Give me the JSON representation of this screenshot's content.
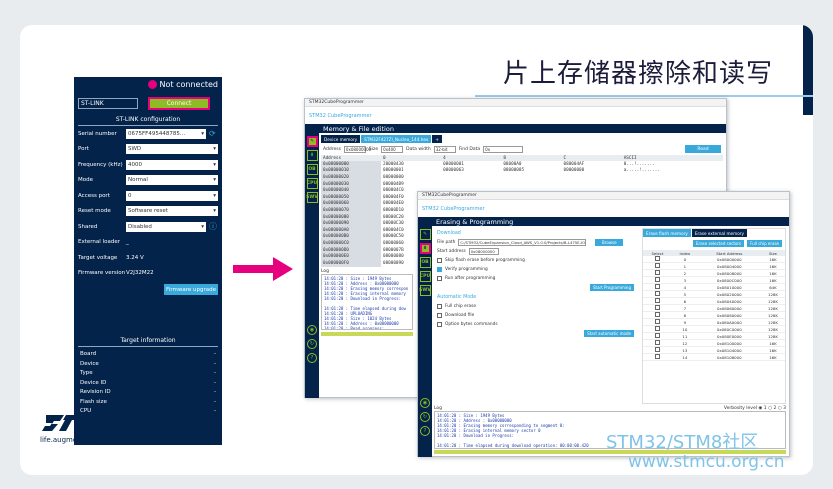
{
  "slide": {
    "title": "片上存储器擦除和读写",
    "brand_text": "life.augmented",
    "watermark_line1": "STM32/STM8社区",
    "watermark_line2": "www.stmcu.org.cn"
  },
  "stlink_panel": {
    "status": "Not connected",
    "interface": "ST-LINK",
    "connect_label": "Connect",
    "config_header": "ST-LINK configuration",
    "fields": [
      {
        "label": "Serial number",
        "value": "0675FF495448785..."
      },
      {
        "label": "Port",
        "value": "SWD"
      },
      {
        "label": "Frequency (kHz)",
        "value": "4000"
      },
      {
        "label": "Mode",
        "value": "Normal"
      },
      {
        "label": "Access port",
        "value": "0"
      },
      {
        "label": "Reset mode",
        "value": "Software reset"
      },
      {
        "label": "Shared",
        "value": "Disabled"
      }
    ],
    "external_loader_label": "External loader",
    "external_loader_value": "_",
    "target_voltage_label": "Target voltage",
    "target_voltage_value": "3.24 V",
    "firmware_label": "Firmware version",
    "firmware_value": "V2J32M22",
    "firmware_upgrade_label": "Firmware upgrade",
    "target_info_header": "Target information",
    "target_info": [
      {
        "label": "Board",
        "value": "-"
      },
      {
        "label": "Device",
        "value": "-"
      },
      {
        "label": "Type",
        "value": "-"
      },
      {
        "label": "Device ID",
        "value": "-"
      },
      {
        "label": "Revision ID",
        "value": "-"
      },
      {
        "label": "Flash size",
        "value": "-"
      },
      {
        "label": "CPU",
        "value": "-"
      }
    ]
  },
  "memory_window": {
    "titlebar": "STM32CubeProgrammer",
    "logo_text": "CubeProgrammer",
    "header": "Memory & File edition",
    "tabs": [
      "Device memory",
      "STM32F427ZI_Nucleo_144.hex",
      "+"
    ],
    "address_label": "Address",
    "address_value": "0x08000000",
    "size_label": "Size",
    "size_value": "0x400",
    "width_label": "Data width",
    "width_value": "32-bit",
    "find_label": "Find Data",
    "find_value": "0x",
    "read_label": "Read",
    "columns": [
      "Address",
      "0",
      "4",
      "8",
      "C",
      "ASCII"
    ],
    "rows": [
      [
        "0x08000000",
        "20000430",
        "08000001",
        "08000A0",
        "080004AF",
        "0...!......."
      ],
      [
        "0x08000010",
        "08000001",
        "08000063",
        "08000085",
        "00000000",
        "a.....!......."
      ],
      [
        "0x08000020",
        "00000000",
        "",
        "",
        "",
        ""
      ],
      [
        "0x08000030",
        "080004B9",
        "",
        "",
        "",
        ""
      ],
      [
        "0x08000040",
        "080004C0",
        "",
        "",
        "",
        ""
      ],
      [
        "0x08000050",
        "080004F0",
        "",
        "",
        "",
        ""
      ],
      [
        "0x08000060",
        "080004E0",
        "",
        "",
        "",
        ""
      ],
      [
        "0x08000070",
        "08000D10",
        "",
        "",
        "",
        ""
      ],
      [
        "0x08000080",
        "08000C20",
        "",
        "",
        "",
        ""
      ],
      [
        "0x08000090",
        "08000C30",
        "",
        "",
        "",
        ""
      ],
      [
        "0x080000A0",
        "080004C0",
        "",
        "",
        "",
        ""
      ],
      [
        "0x080000B0",
        "08000C50",
        "",
        "",
        "",
        ""
      ],
      [
        "0x080000C0",
        "08000060",
        "",
        "",
        "",
        ""
      ],
      [
        "0x080000D0",
        "0800007B",
        "",
        "",
        "",
        ""
      ],
      [
        "0x080000E0",
        "08000080",
        "",
        "",
        "",
        ""
      ],
      [
        "0x080000F0",
        "08000090",
        "",
        "",
        "",
        ""
      ]
    ],
    "log_label": "Log",
    "log_lines": [
      "14:01:20 : Size : 1949 Bytes",
      "14:01:20 : Address : 0x08000000",
      "14:01:20 : Erasing memory correspon",
      "14:01:20 : Erasing internal memory",
      "14:01:20 : Download in Progress:",
      "",
      "14:01:20 : Time elapsed during dow",
      "14:01:20 : UPLOADING",
      "14:01:20 : Size : 1024 Bytes",
      "14:01:20 : Address : 0x08000000",
      "14:01:20 : Read progress:",
      "",
      "14:01:20 : Time elapsed during the"
    ]
  },
  "erase_window": {
    "titlebar": "STM32CubeProgrammer",
    "logo_text": "CubeProgrammer",
    "header": "Erasing & Programming",
    "download_title": "Download",
    "file_path_label": "File path",
    "file_path_value": "C:/STM32/CubeExpansion_Cloud_AWS_V1.0.0/Projects/B-L475E-IOT01A/Applications",
    "browse_label": "Browse",
    "start_address_label": "Start address",
    "start_address_value": "0x08000000",
    "checkboxes": [
      {
        "label": "Skip flash erase before programming",
        "checked": false
      },
      {
        "label": "Verify programming",
        "checked": true
      },
      {
        "label": "Run after programming",
        "checked": false
      }
    ],
    "start_prog_label": "Start Programming",
    "auto_mode_title": "Automatic Mode",
    "auto_checkboxes": [
      {
        "label": "Full chip erase",
        "checked": false
      },
      {
        "label": "Download file",
        "checked": false
      },
      {
        "label": "Option bytes commands",
        "checked": false
      }
    ],
    "start_auto_label": "Start automatic mode",
    "sector_tabs": [
      "Erase flash memory",
      "Erase external memory"
    ],
    "erase_selected_label": "Erase selected sectors",
    "full_erase_label": "Full chip erase",
    "sector_columns": [
      "Select",
      "Index",
      "Start Address",
      "Size"
    ],
    "sectors": [
      [
        "0",
        "0x08000000",
        "16K"
      ],
      [
        "1",
        "0x08004000",
        "16K"
      ],
      [
        "2",
        "0x08008000",
        "16K"
      ],
      [
        "3",
        "0x0800C000",
        "16K"
      ],
      [
        "4",
        "0x08010000",
        "64K"
      ],
      [
        "5",
        "0x08020000",
        "128K"
      ],
      [
        "6",
        "0x08040000",
        "128K"
      ],
      [
        "7",
        "0x08060000",
        "128K"
      ],
      [
        "8",
        "0x08080000",
        "128K"
      ],
      [
        "9",
        "0x080A0000",
        "128K"
      ],
      [
        "10",
        "0x080C0000",
        "128K"
      ],
      [
        "11",
        "0x080E0000",
        "128K"
      ],
      [
        "12",
        "0x08100000",
        "16K"
      ],
      [
        "13",
        "0x08104000",
        "16K"
      ],
      [
        "14",
        "0x08108000",
        "16K"
      ]
    ],
    "log_label": "Log",
    "verbosity_label": "Verbosity level",
    "verbosity_options": [
      "1",
      "2",
      "3"
    ],
    "log_lines": [
      "14:01:20 : Size : 1949 Bytes",
      "14:01:20 : Address : 0x08000000",
      "14:01:20 : Erasing memory corresponding to segment 0:",
      "14:01:20 : Erasing internal memory sector 0",
      "14:01:20 : Download in Progress:",
      "",
      "14:01:20 : Time elapsed during download operation: 00:00:00.420",
      "14:01:20 : UPLOADING",
      "14:01:20 : Size : 1024 Bytes",
      "14:01:20 : Address : 0x08000000",
      "14:01:20 : Read progress:",
      "",
      "14:01:20 : Time elapsed during the read operation is: 00:00:00.007"
    ]
  }
}
